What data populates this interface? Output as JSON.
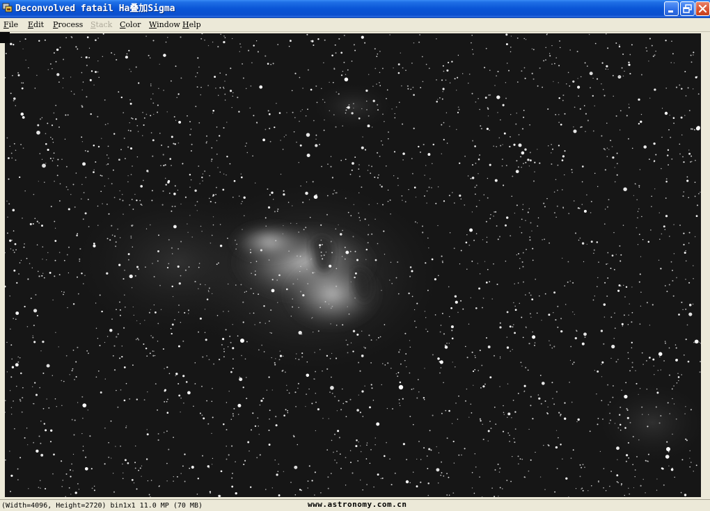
{
  "window": {
    "title": "Deconvolved fatail Ha叠加Sigma",
    "controls": {
      "minimize_icon": "minimize-icon",
      "restore_icon": "restore-icon",
      "close_icon": "close-icon"
    }
  },
  "menu": [
    {
      "label": "File",
      "enabled": true
    },
    {
      "label": "Edit",
      "enabled": true
    },
    {
      "label": "Process",
      "enabled": true
    },
    {
      "label": "Stack",
      "enabled": false
    },
    {
      "label": "Color",
      "enabled": true
    },
    {
      "label": "Window",
      "enabled": true
    },
    {
      "label": "Help",
      "enabled": true
    }
  ],
  "image": {
    "subject_icon": "nebula-starfield-image"
  },
  "status": {
    "info": "(Width=4096, Height=2720) bin1x1  11.0 MP (70 MB)",
    "watermark": "www.astronomy.com.cn"
  },
  "colors": {
    "titlebar": "#0a55d6",
    "chrome": "#ece9d8",
    "image_background": "#121212",
    "close_button": "#d8502e"
  }
}
